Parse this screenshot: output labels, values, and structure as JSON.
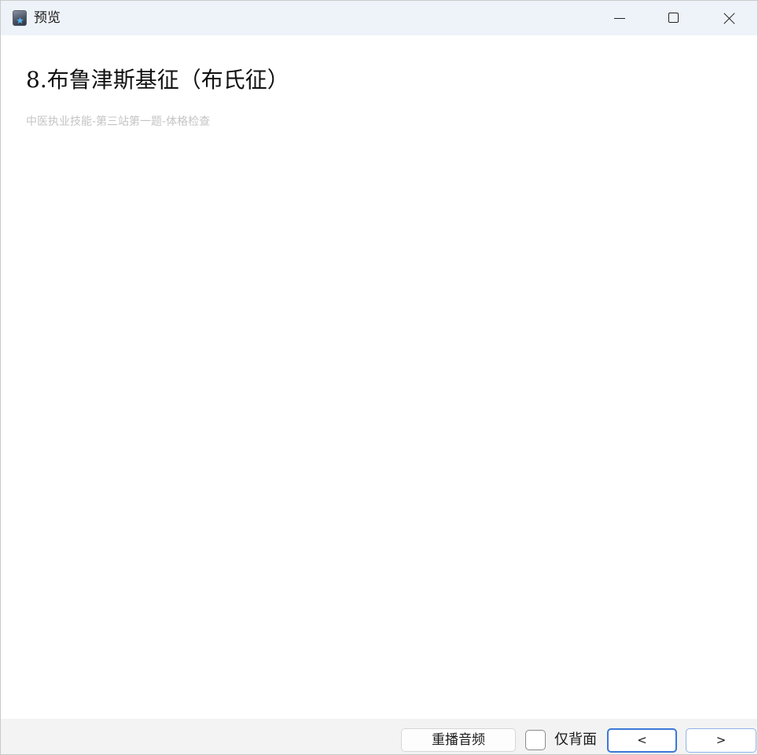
{
  "window": {
    "title": "预览",
    "app_icon": "star-app-icon",
    "controls": {
      "minimize_icon": "minimize-icon",
      "maximize_icon": "maximize-icon",
      "close_icon": "close-icon"
    }
  },
  "content": {
    "heading": "8.布鲁津斯基征（布氏征）",
    "subtitle": "中医执业技能-第三站第一题-体格检查"
  },
  "footer": {
    "replay_label": "重播音频",
    "back_only_label": "仅背面",
    "back_only_checked": false,
    "prev_label": "<",
    "next_label": ">"
  },
  "colors": {
    "titlebar_bg": "#eef3f9",
    "footer_bg": "#f3f3f3",
    "accent": "#3b78d8",
    "subtitle": "#c4c4c4"
  }
}
